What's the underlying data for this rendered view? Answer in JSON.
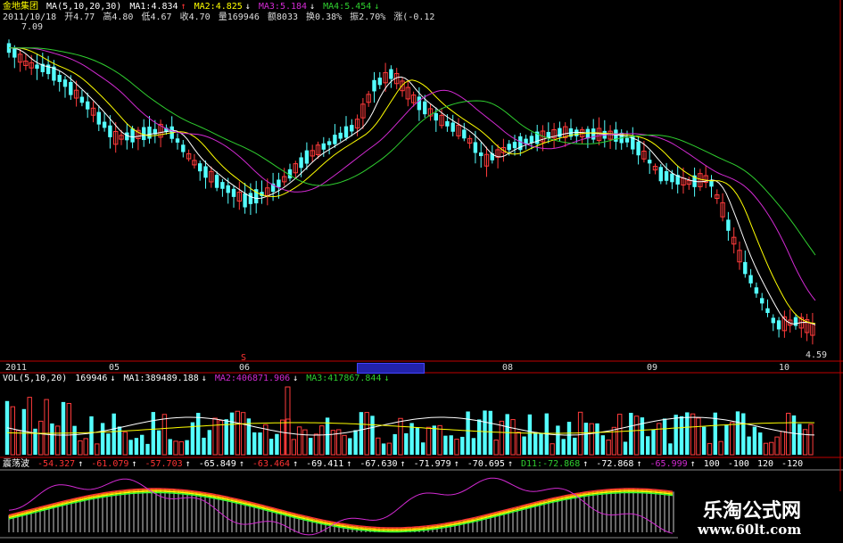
{
  "header": {
    "stock_name": "金地集团",
    "ma_label": "MA(5,10,20,30)",
    "ma1": "MA1:4.834",
    "ma2": "MA2:4.825",
    "ma3": "MA3:5.184",
    "ma4": "MA4:5.454",
    "date": "2011/10/18",
    "open": "开4.77",
    "high": "高4.80",
    "low": "低4.67",
    "close": "收4.70",
    "volume": "量169946",
    "amount": "额8033",
    "turnover": "换0.38%",
    "amplitude": "振2.70%",
    "change": "涨(-0.12"
  },
  "price": {
    "high_label": "7.09",
    "low_label": "4.59"
  },
  "time_axis": {
    "labels": [
      "2011",
      "05",
      "06",
      "S",
      "08",
      "09",
      "10"
    ]
  },
  "volume_panel": {
    "title": "VOL(5,10,20)",
    "vol": "169946",
    "ma1": "MA1:389489.188",
    "ma2": "MA2:406871.906",
    "ma3": "MA3:417867.844"
  },
  "osc_panel": {
    "title": "震荡波",
    "values": [
      "-54.327",
      "-61.079",
      "-57.703",
      "-65.849",
      "-63.464",
      "-69.411",
      "-67.630",
      "-71.979",
      "-70.695"
    ],
    "d11": "D11:-72.868",
    "tail": [
      "-72.868",
      "-65.999",
      "100",
      "-100",
      "120",
      "-120"
    ]
  },
  "watermark": {
    "name": "乐淘公式网",
    "url": "www.60lt.com"
  },
  "colors": {
    "up": "#ff3b3b",
    "down": "#54ffff",
    "ma_white": "#ffffff",
    "ma_yellow": "#ffff00",
    "ma_magenta": "#d22ad2",
    "ma_green": "#2fcf2f",
    "axis_red": "#c00000"
  }
}
